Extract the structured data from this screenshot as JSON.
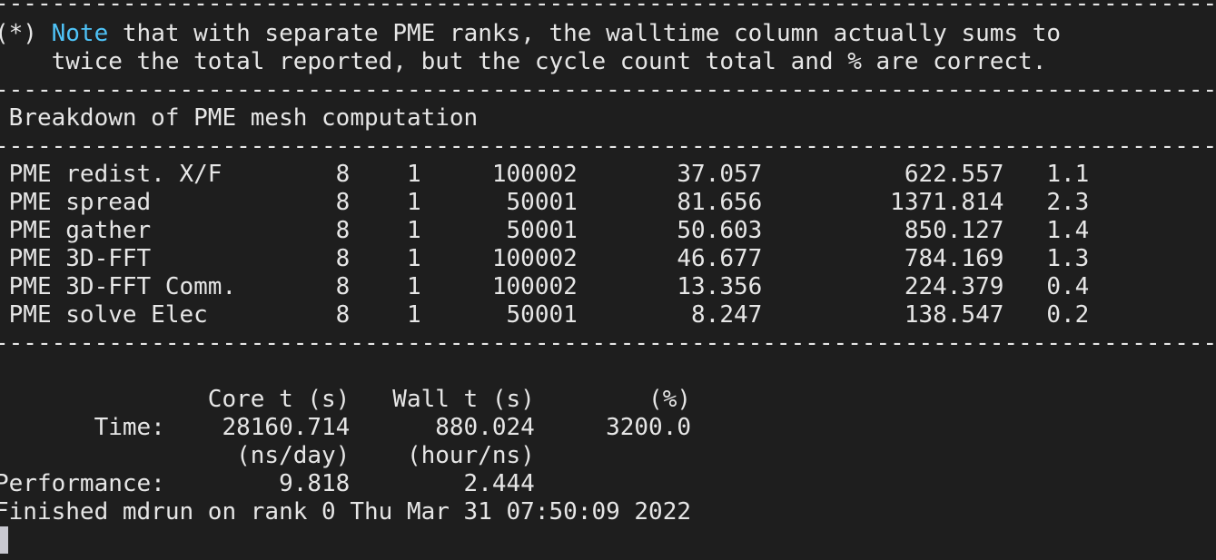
{
  "terminal": {
    "separator": "----------------------------------------------------------------------------------------------------------------------------------------------------",
    "footnote": {
      "prefix": "(*) ",
      "note_word": "Note",
      "line1_rest": " that with separate PME ranks, the walltime column actually sums to",
      "line2": "    twice the total reported, but the cycle count total and % are correct."
    },
    "pme_section_title": " Breakdown of PME mesh computation",
    "pme_rows": [
      " PME redist. X/F        8    1     100002       37.057          622.557   1.1",
      " PME spread             8    1      50001       81.656         1371.814   2.3",
      " PME gather             8    1      50001       50.603          850.127   1.4",
      " PME 3D-FFT             8    1     100002       46.677          784.169   1.3",
      " PME 3D-FFT Comm.       8    1     100002       13.356          224.379   0.4",
      " PME solve Elec         8    1      50001        8.247          138.547   0.2"
    ],
    "timing": {
      "header": "               Core t (s)   Wall t (s)        (%)",
      "time_row": "       Time:    28160.714      880.024     3200.0",
      "units_row": "                 (ns/day)    (hour/ns)",
      "performance_row": "Performance:        9.818        2.444"
    },
    "finished_line": "Finished mdrun on rank 0 Thu Mar 31 07:50:09 2022"
  }
}
